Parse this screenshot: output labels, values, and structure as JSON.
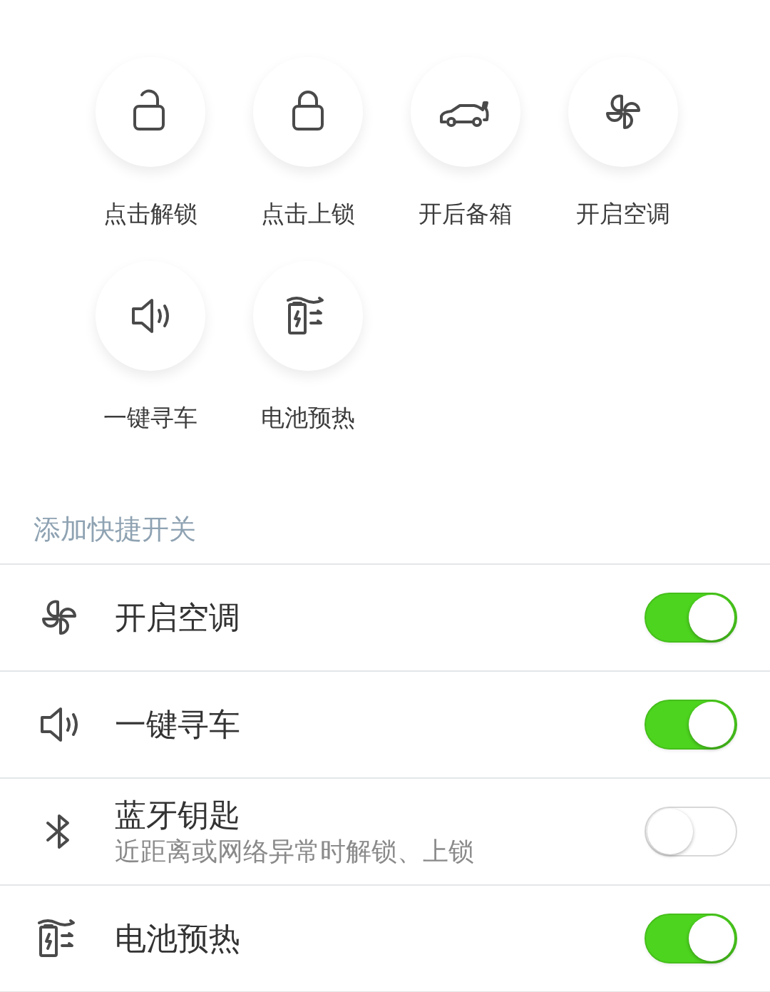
{
  "quick_actions": [
    {
      "kind": "unlock",
      "label": "点击解锁"
    },
    {
      "kind": "lock",
      "label": "点击上锁"
    },
    {
      "kind": "trunk",
      "label": "开后备箱"
    },
    {
      "kind": "fan",
      "label": "开启空调"
    },
    {
      "kind": "horn",
      "label": "一键寻车"
    },
    {
      "kind": "battery",
      "label": "电池预热"
    }
  ],
  "section_title": "添加快捷开关",
  "switches": [
    {
      "kind": "fan",
      "label": "开启空调",
      "on": true
    },
    {
      "kind": "horn",
      "label": "一键寻车",
      "on": true
    },
    {
      "kind": "bluetooth",
      "label": "蓝牙钥匙",
      "description": "近距离或网络异常时解锁、上锁",
      "on": false
    },
    {
      "kind": "battery",
      "label": "电池预热",
      "on": true
    }
  ]
}
